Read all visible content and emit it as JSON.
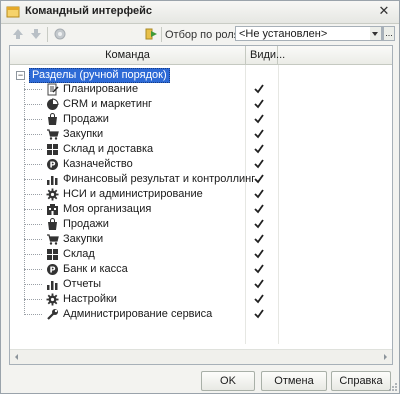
{
  "window": {
    "title": "Командный интерфейс"
  },
  "toolbar": {
    "filter_label": "Отбор по ролям:",
    "filter_value": "<Не установлен>",
    "more_button": "..."
  },
  "grid": {
    "columns": {
      "command": "Команда",
      "visible": "Види..."
    },
    "root": {
      "label": "Разделы (ручной порядок)",
      "expanded": true
    },
    "items": [
      {
        "label": "Планирование",
        "icon": "planning-icon",
        "checked": true
      },
      {
        "label": "CRM и маркетинг",
        "icon": "crm-icon",
        "checked": true
      },
      {
        "label": "Продажи",
        "icon": "sales-bag-icon",
        "checked": true
      },
      {
        "label": "Закупки",
        "icon": "cart-icon",
        "checked": true
      },
      {
        "label": "Склад и доставка",
        "icon": "warehouse-icon",
        "checked": true
      },
      {
        "label": "Казначейство",
        "icon": "treasury-icon",
        "checked": true
      },
      {
        "label": "Финансовый результат и контроллинг",
        "icon": "bar-chart-icon",
        "checked": true
      },
      {
        "label": "НСИ и администрирование",
        "icon": "gear-icon",
        "checked": true
      },
      {
        "label": "Моя организация",
        "icon": "organization-icon",
        "checked": true
      },
      {
        "label": "Продажи",
        "icon": "sales-bag-icon",
        "checked": true
      },
      {
        "label": "Закупки",
        "icon": "cart-icon",
        "checked": true
      },
      {
        "label": "Склад",
        "icon": "warehouse-icon",
        "checked": true
      },
      {
        "label": "Банк и касса",
        "icon": "treasury-icon",
        "checked": true
      },
      {
        "label": "Отчеты",
        "icon": "bar-chart-icon",
        "checked": true
      },
      {
        "label": "Настройки",
        "icon": "gear-icon",
        "checked": true
      },
      {
        "label": "Администрирование сервиса",
        "icon": "wrench-icon",
        "checked": true
      }
    ]
  },
  "buttons": {
    "ok": "OK",
    "cancel": "Отмена",
    "help": "Справка"
  }
}
